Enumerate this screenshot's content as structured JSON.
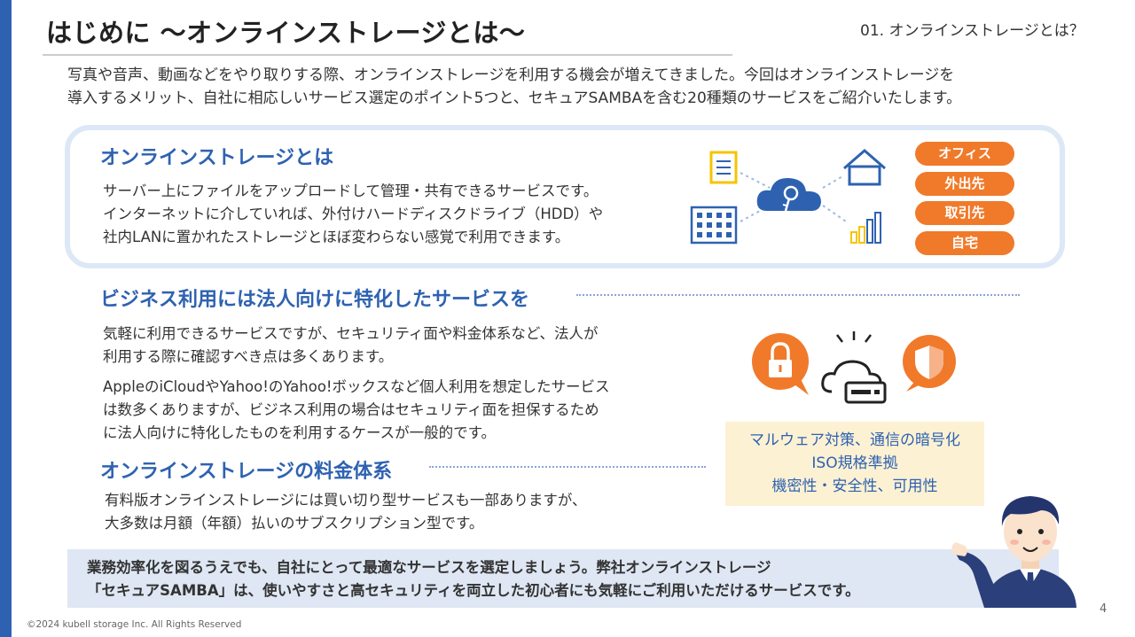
{
  "header": {
    "title": "はじめに 〜オンラインストレージとは〜",
    "section_label": "01. オンラインストレージとは？"
  },
  "intro": {
    "line1": "写真や音声、動画などをやり取りする際、オンラインストレージを利用する機会が増えてきました。今回はオンラインストレージを",
    "line2": "導入するメリット、自社に相応しいサービス選定のポイント5つと、セキュアSAMBAを含む20種類のサービスをご紹介いたします。"
  },
  "definition": {
    "heading": "オンラインストレージとは",
    "line1": "サーバー上にファイルをアップロードして管理・共有できるサービスです。",
    "line2": "インターネットに介していれば、外付けハードディスクドライブ（HDD）や",
    "line3": "社内LANに置かれたストレージとほぼ変わらない感覚で利用できます。",
    "tags": [
      "オフィス",
      "外出先",
      "取引先",
      "自宅"
    ]
  },
  "business": {
    "heading": "ビジネス利用には法人向けに特化したサービスを",
    "para1_line1": "気軽に利用できるサービスですが、セキュリティ面や料金体系など、法人が",
    "para1_line2": "利用する際に確認すべき点は多くあります。",
    "para2_line1": "AppleのiCloudやYahoo!のYahoo!ボックスなど個人利用を想定したサービス",
    "para2_line2": "は数多くありますが、ビジネス利用の場合はセキュリティ面を担保するため",
    "para2_line3": "に法人向けに特化したものを利用するケースが一般的です。",
    "features": [
      "マルウェア対策、通信の暗号化",
      "ISO規格準拠",
      "機密性・安全性、可用性"
    ]
  },
  "pricing": {
    "heading": "オンラインストレージの料金体系",
    "line1": "有料版オンラインストレージには買い切り型サービスも一部ありますが、",
    "line2": "大多数は月額（年額）払いのサブスクリプション型です。"
  },
  "callout": {
    "line1": "業務効率化を図るうえでも、自社にとって最適なサービスを選定しましょう。弊社オンラインストレージ",
    "line2": "「セキュアSAMBA」は、使いやすさと高セキュリティを両立した初心者にも気軽にご利用いただけるサービスです。"
  },
  "footer": {
    "copyright": "©2024 kubell storage Inc. All Rights Reserved",
    "page_number": "4"
  },
  "colors": {
    "accent_blue": "#2e62b1",
    "orange": "#f07a2a",
    "card_border": "#dde8f6",
    "feature_bg": "#fdf1d3",
    "callout_bg": "#dfe7f4"
  }
}
